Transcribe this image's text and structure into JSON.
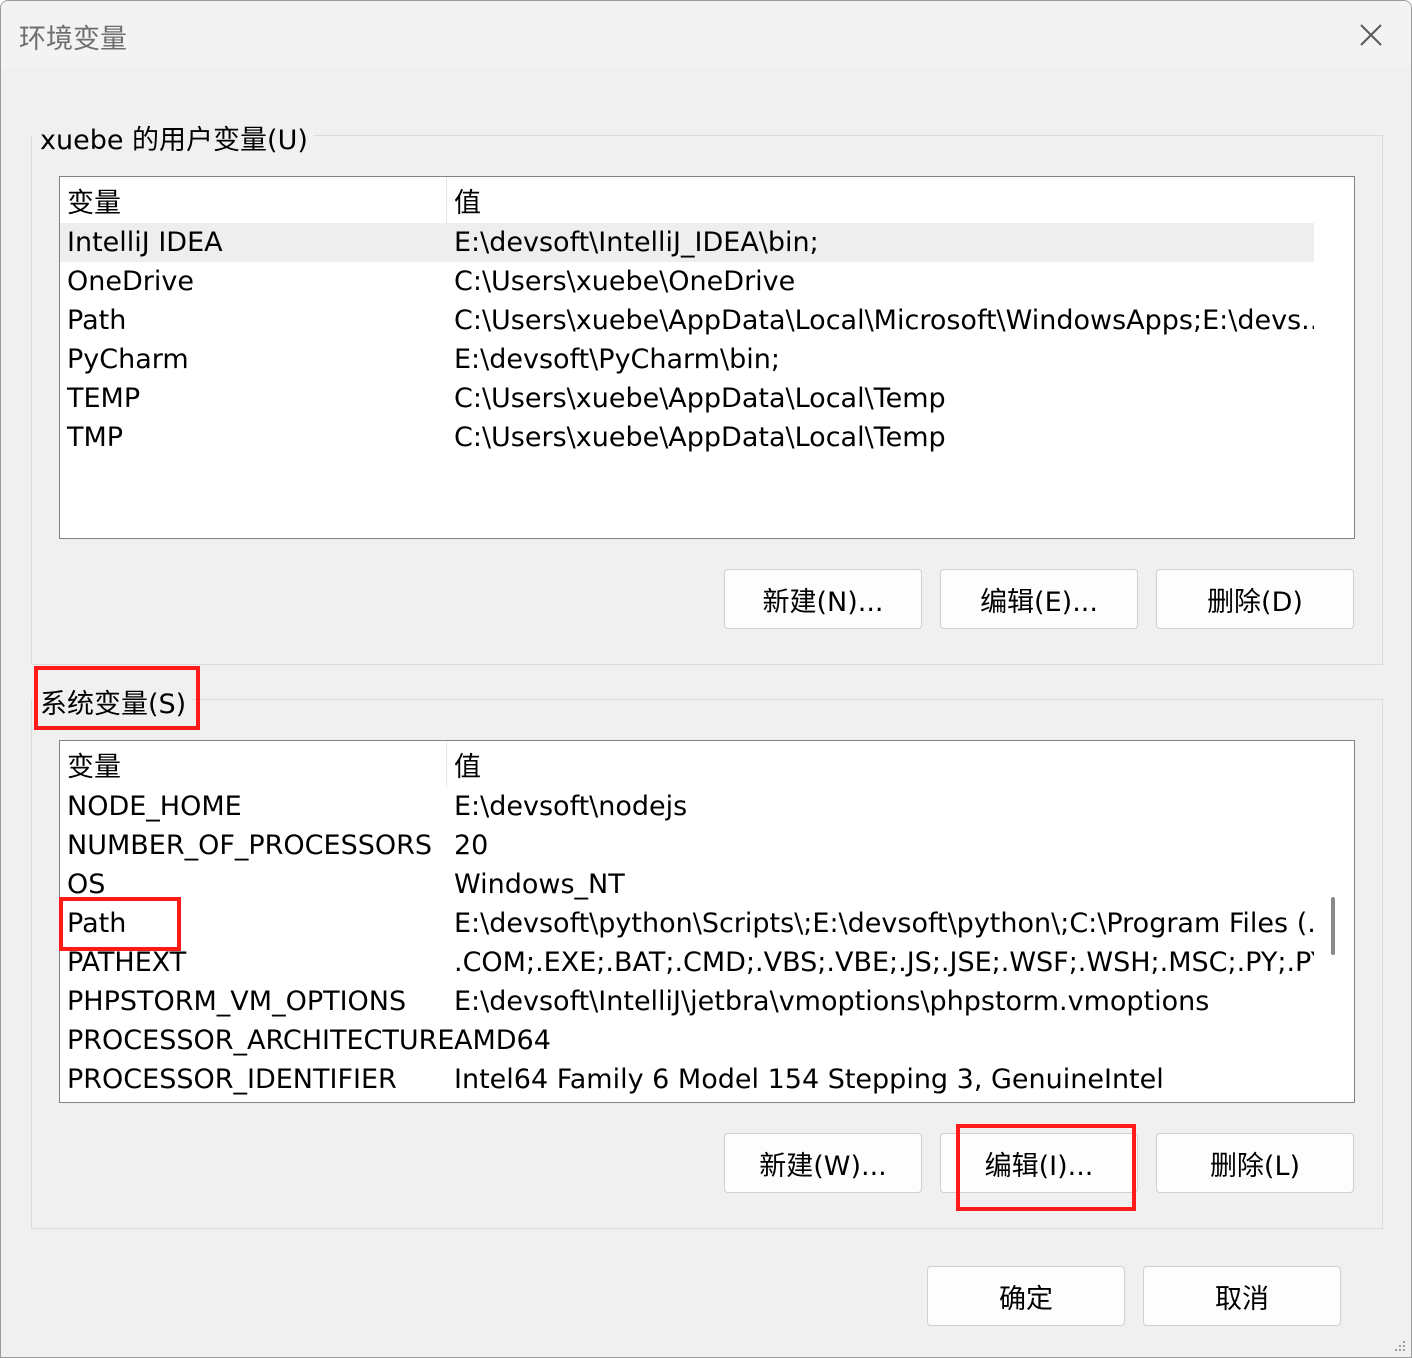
{
  "window": {
    "title": "环境变量"
  },
  "user_vars": {
    "label": "xuebe 的用户变量(U)",
    "header": {
      "name": "变量",
      "value": "值"
    },
    "rows": [
      {
        "name": "IntelliJ IDEA",
        "value": "E:\\devsoft\\IntelliJ_IDEA\\bin;"
      },
      {
        "name": "OneDrive",
        "value": "C:\\Users\\xuebe\\OneDrive"
      },
      {
        "name": "Path",
        "value": "C:\\Users\\xuebe\\AppData\\Local\\Microsoft\\WindowsApps;E:\\devs..."
      },
      {
        "name": "PyCharm",
        "value": "E:\\devsoft\\PyCharm\\bin;"
      },
      {
        "name": "TEMP",
        "value": "C:\\Users\\xuebe\\AppData\\Local\\Temp"
      },
      {
        "name": "TMP",
        "value": "C:\\Users\\xuebe\\AppData\\Local\\Temp"
      }
    ],
    "selected_row": "IntelliJ IDEA",
    "buttons": {
      "new": "新建(N)...",
      "edit": "编辑(E)...",
      "delete": "删除(D)"
    }
  },
  "system_vars": {
    "label": "系统变量(S)",
    "header": {
      "name": "变量",
      "value": "值"
    },
    "rows": [
      {
        "name": "NODE_HOME",
        "value": "E:\\devsoft\\nodejs"
      },
      {
        "name": "NUMBER_OF_PROCESSORS",
        "value": "20"
      },
      {
        "name": "OS",
        "value": "Windows_NT"
      },
      {
        "name": "Path",
        "value": "E:\\devsoft\\python\\Scripts\\;E:\\devsoft\\python\\;C:\\Program Files (..."
      },
      {
        "name": "PATHEXT",
        "value": ".COM;.EXE;.BAT;.CMD;.VBS;.VBE;.JS;.JSE;.WSF;.WSH;.MSC;.PY;.PYW"
      },
      {
        "name": "PHPSTORM_VM_OPTIONS",
        "value": "E:\\devsoft\\IntelliJ\\jetbra\\vmoptions\\phpstorm.vmoptions"
      },
      {
        "name": "PROCESSOR_ARCHITECTURE",
        "value": "AMD64"
      },
      {
        "name": "PROCESSOR_IDENTIFIER",
        "value": "Intel64 Family 6 Model 154 Stepping 3, GenuineIntel"
      }
    ],
    "buttons": {
      "new": "新建(W)...",
      "edit": "编辑(I)...",
      "delete": "删除(L)"
    }
  },
  "footer": {
    "ok": "确定",
    "cancel": "取消"
  },
  "annotation": {
    "highlight_color": "#ff1a1a"
  },
  "icons": {
    "close": "close-icon",
    "grip": "resize-grip-icon"
  }
}
